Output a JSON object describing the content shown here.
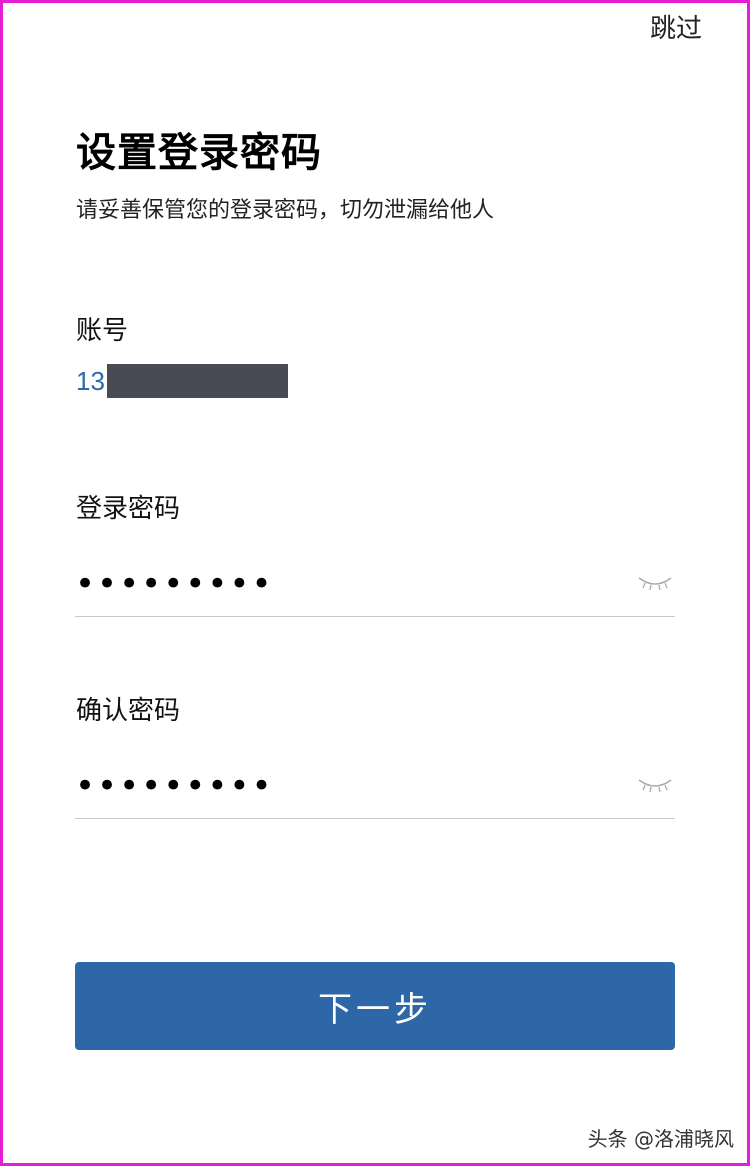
{
  "header": {
    "skip_label": "跳过"
  },
  "main": {
    "title": "设置登录密码",
    "subtitle": "请妥善保管您的登录密码，切勿泄漏给他人",
    "account": {
      "label": "账号",
      "value_visible": "13"
    },
    "password": {
      "label": "登录密码",
      "value": "•••••••••"
    },
    "confirm_password": {
      "label": "确认密码",
      "value": "•••••••••"
    },
    "next_button_label": "下一步"
  },
  "watermark": "头条 @洛浦晓风",
  "colors": {
    "frame": "#e61ed2",
    "accent": "#2e67a8",
    "account_text": "#2d6aad",
    "redaction": "#4a4a55"
  },
  "icons": {
    "password_toggle": "eye-closed-icon",
    "confirm_toggle": "eye-closed-icon"
  }
}
